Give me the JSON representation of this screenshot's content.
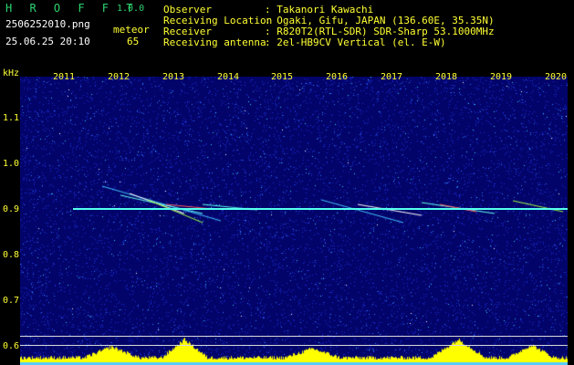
{
  "app": {
    "name": "H R O F F T",
    "version": "1.0.0"
  },
  "file": {
    "name": "2506252010.png",
    "datetime": "25.06.25 20:10"
  },
  "meteor": {
    "label": "meteor",
    "count": "65"
  },
  "info": {
    "observer_label": "Observer",
    "observer_value": ": Takanori Kawachi",
    "location_label": "Receiving Location",
    "location_value": ": Ogaki, Gifu, JAPAN (136.60E, 35.35N)",
    "receiver_label": "Receiver",
    "receiver_value": ": R820T2(RTL-SDR) SDR-Sharp 53.1000MHz",
    "antenna_label": "Receiving antenna",
    "antenna_value": ": 2el-HB9CV Vertical (el. E-W)"
  },
  "axis": {
    "y_unit": "kHz",
    "y_ticks": [
      "1.1",
      "1.0",
      "0.9",
      "0.8",
      "0.7",
      "0.6"
    ],
    "x_ticks": [
      "2011",
      "2012",
      "2013",
      "2014",
      "2015",
      "2016",
      "2017",
      "2018",
      "2019",
      "2020"
    ]
  },
  "colors": {
    "text_green": "#2dd36f",
    "text_yellow": "#ffff33",
    "background_field": "#03046a",
    "signal": "#55ffee"
  }
}
